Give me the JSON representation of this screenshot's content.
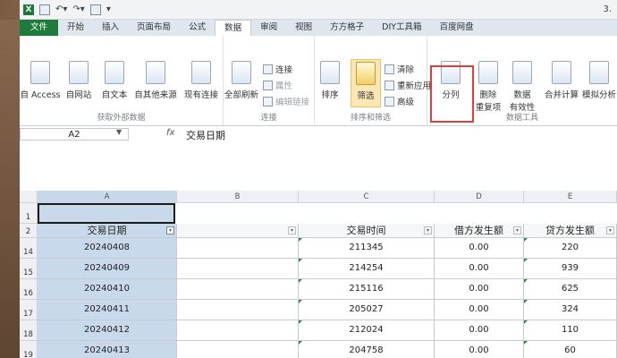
{
  "qat": {
    "version_label": "3."
  },
  "tabs": [
    "文件",
    "开始",
    "插入",
    "页面布局",
    "公式",
    "数据",
    "审阅",
    "视图",
    "方方格子",
    "DIY工具箱",
    "百度网盘"
  ],
  "ribbon": {
    "get_external": {
      "title": "获取外部数据",
      "access": "自 Access",
      "web": "自网站",
      "text": "自文本",
      "other": "自其他来源",
      "existing": "现有连接"
    },
    "connections": {
      "title": "连接",
      "refresh_all": "全部刷新",
      "connections": "连接",
      "properties": "属性",
      "edit_links": "编辑链接"
    },
    "sort_filter": {
      "title": "排序和筛选",
      "sort": "排序",
      "filter": "筛选",
      "clear": "清除",
      "reapply": "重新应用",
      "advanced": "高级"
    },
    "data_tools": {
      "title": "数据工具",
      "text_to_columns": "分列",
      "remove_dup_1": "删除",
      "remove_dup_2": "重复项",
      "validation_1": "数据",
      "validation_2": "有效性",
      "consolidate": "合并计算",
      "what_if": "模拟分析"
    }
  },
  "formula_bar": {
    "name_box": "A2",
    "fx": "fx",
    "content": "交易日期"
  },
  "columns": [
    "A",
    "B",
    "C",
    "D",
    "E"
  ],
  "header_row": {
    "a": "交易日期",
    "b": "",
    "c": "交易时间",
    "d": "借方发生额",
    "e": "贷方发生额"
  },
  "rows": [
    {
      "num": "14",
      "a": "20240408",
      "c": "211345",
      "d": "0.00",
      "e": "220"
    },
    {
      "num": "15",
      "a": "20240409",
      "c": "214254",
      "d": "0.00",
      "e": "939"
    },
    {
      "num": "16",
      "a": "20240410",
      "c": "215116",
      "d": "0.00",
      "e": "625"
    },
    {
      "num": "17",
      "a": "20240411",
      "c": "205027",
      "d": "0.00",
      "e": "324"
    },
    {
      "num": "18",
      "a": "20240412",
      "c": "212024",
      "d": "0.00",
      "e": "110"
    },
    {
      "num": "19",
      "a": "20240413",
      "c": "204758",
      "d": "0.00",
      "e": "60"
    }
  ],
  "row_labels": {
    "r1": "1",
    "r2": "2"
  }
}
